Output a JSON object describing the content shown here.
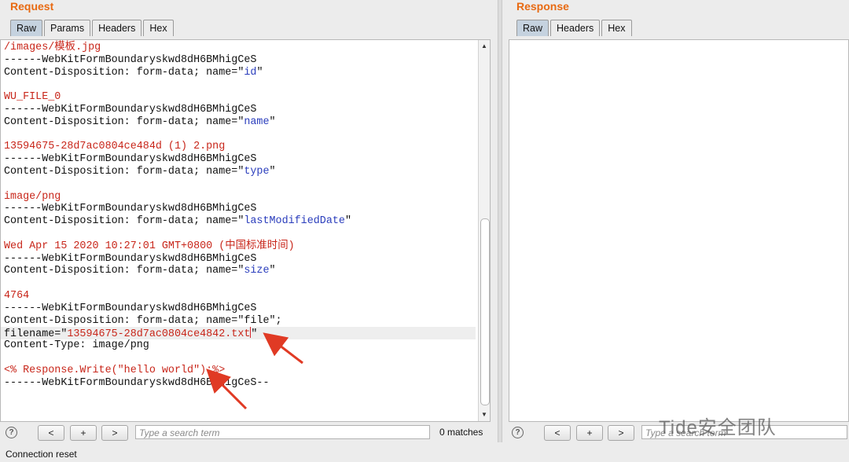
{
  "request": {
    "title": "Request",
    "tabs": [
      "Raw",
      "Params",
      "Headers",
      "Hex"
    ],
    "lines": [
      {
        "text": "/images/模板.jpg",
        "color": "red"
      },
      {
        "text": "------WebKitFormBoundaryskwd8dH6BMhigCeS",
        "color": "black"
      },
      {
        "prefix": "Content-Disposition: form-data; name=\"",
        "value": "id",
        "suffix": "\""
      },
      {
        "text": "",
        "color": "black"
      },
      {
        "text": "WU_FILE_0",
        "color": "red"
      },
      {
        "text": "------WebKitFormBoundaryskwd8dH6BMhigCeS",
        "color": "black"
      },
      {
        "prefix": "Content-Disposition: form-data; name=\"",
        "value": "name",
        "suffix": "\""
      },
      {
        "text": "",
        "color": "black"
      },
      {
        "text": "13594675-28d7ac0804ce484d (1) 2.png",
        "color": "red"
      },
      {
        "text": "------WebKitFormBoundaryskwd8dH6BMhigCeS",
        "color": "black"
      },
      {
        "prefix": "Content-Disposition: form-data; name=\"",
        "value": "type",
        "suffix": "\""
      },
      {
        "text": "",
        "color": "black"
      },
      {
        "text": "image/png",
        "color": "red"
      },
      {
        "text": "------WebKitFormBoundaryskwd8dH6BMhigCeS",
        "color": "black"
      },
      {
        "prefix": "Content-Disposition: form-data; name=\"",
        "value": "lastModifiedDate",
        "suffix": "\""
      },
      {
        "text": "",
        "color": "black"
      },
      {
        "text": "Wed Apr 15 2020 10:27:01 GMT+0800 (中国标准时间)",
        "color": "red"
      },
      {
        "text": "------WebKitFormBoundaryskwd8dH6BMhigCeS",
        "color": "black"
      },
      {
        "prefix": "Content-Disposition: form-data; name=\"",
        "value": "size",
        "suffix": "\""
      },
      {
        "text": "",
        "color": "black"
      },
      {
        "text": "4764",
        "color": "red"
      },
      {
        "text": "------WebKitFormBoundaryskwd8dH6BMhigCeS",
        "color": "black"
      },
      {
        "text": "Content-Disposition: form-data; name=\"file\";",
        "color": "black"
      },
      {
        "prefix": "filename=\"",
        "value": "13594675-28d7ac0804ce4842.txt",
        "suffix": "\"",
        "valueColor": "red",
        "highlight": true
      },
      {
        "text": "Content-Type: image/png",
        "color": "black"
      },
      {
        "text": "",
        "color": "black"
      },
      {
        "text": "<% Response.Write(\"hello world\");%>",
        "color": "red"
      },
      {
        "text": "------WebKitFormBoundaryskwd8dH6BMhigCeS--",
        "color": "black"
      }
    ],
    "help": "?",
    "prev": "<",
    "add": "+",
    "next": ">",
    "search_placeholder": "Type a search term",
    "matches": "0 matches"
  },
  "response": {
    "title": "Response",
    "tabs": [
      "Raw",
      "Headers",
      "Hex"
    ],
    "help": "?",
    "prev": "<",
    "add": "+",
    "next": ">",
    "search_placeholder": "Type a search term"
  },
  "status": "Connection reset",
  "watermark": "Tide安全团队",
  "colors": {
    "title": "#e86a12",
    "active_tab": "#c5d2df",
    "red": "#c8261a",
    "blue": "#2a3dbc",
    "arrow": "#e03a24"
  },
  "annotations": [
    "red-arrow-filename",
    "red-arrow-payload"
  ]
}
